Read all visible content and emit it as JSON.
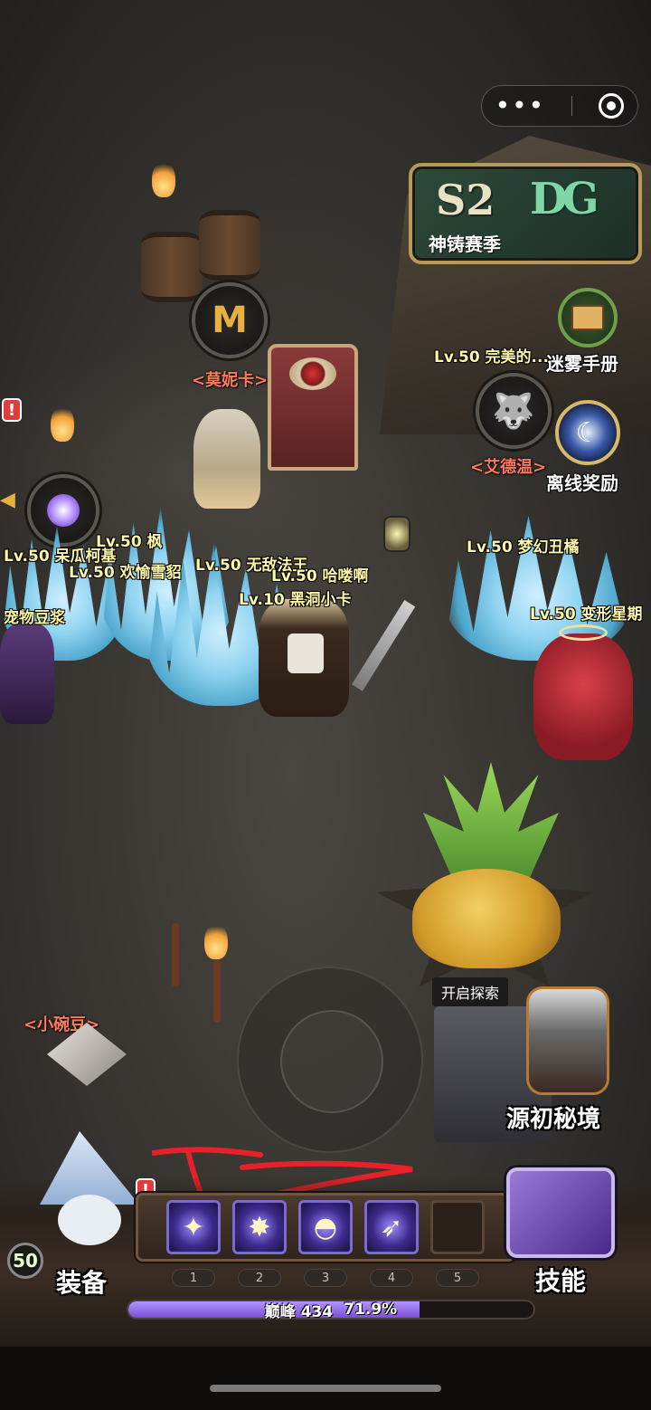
{
  "topbar": {
    "menu_icon": "more-dots-icon",
    "close_icon": "target-circle-icon"
  },
  "season": {
    "tag": "S2",
    "logo": "DG",
    "title": "神铸赛季"
  },
  "side_buttons": {
    "fog_manual": "迷雾手册",
    "offline_reward": "离线奖励"
  },
  "npcs": {
    "monica": "<莫妮卡>",
    "edwin": "<艾德温>",
    "little_bowl": "<小碗豆>"
  },
  "units": [
    {
      "label": "Lv.50 完美的..."
    },
    {
      "label": "Lv.50 呆瓜柯基"
    },
    {
      "label": "Lv.50 枫"
    },
    {
      "label": "Lv.50 欢愉雪貂"
    },
    {
      "label": "Lv.50 无敌法王"
    },
    {
      "label": "Lv.50 哈喽啊"
    },
    {
      "label": "Lv.10 黑洞小卡"
    },
    {
      "label": "Lv.50 梦幻丑橘"
    },
    {
      "label": "Lv.50 变形星期"
    },
    {
      "label": "宠物豆浆"
    }
  ],
  "explore": {
    "tag": "开启探索",
    "portal": "源初秘境"
  },
  "hud": {
    "level": "50",
    "equip_label": "装备",
    "skill_label": "技能",
    "slots": [
      "1",
      "2",
      "3",
      "4",
      "5"
    ],
    "peak_label": "巅峰",
    "peak_value": "434",
    "progress_text": "71.9%",
    "progress": 0.719
  },
  "colors": {
    "accent_purple": "#8a5ce6",
    "npc_name": "#ff7a5c",
    "unit_label": "#fff7a8"
  }
}
